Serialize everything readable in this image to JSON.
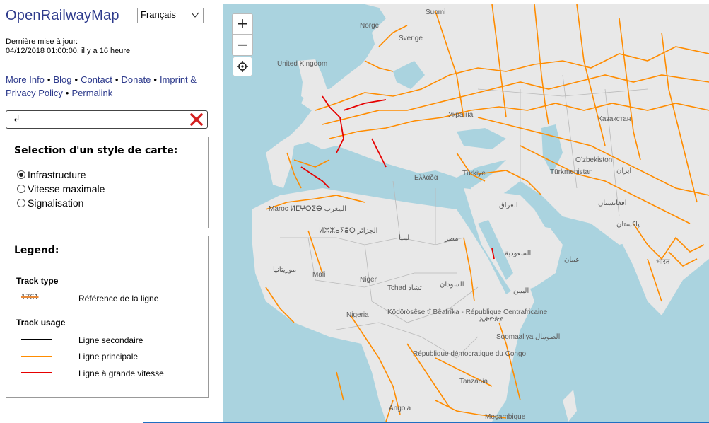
{
  "site": {
    "title": "OpenRailwayMap",
    "language_selected": "Français",
    "update_label": "Dernière mise à jour:",
    "update_value": "04/12/2018 01:00:00, il y a 16 heure"
  },
  "links": [
    "More Info",
    "Blog",
    "Contact",
    "Donate",
    "Imprint &",
    "Privacy Policy",
    "Permalink"
  ],
  "search": {
    "value": "↲"
  },
  "style_panel": {
    "title": "Selection d'un style de carte:",
    "options": [
      {
        "label": "Infrastructure",
        "selected": true
      },
      {
        "label": "Vitesse maximale",
        "selected": false
      },
      {
        "label": "Signalisation",
        "selected": false
      }
    ]
  },
  "legend": {
    "title": "Legend:",
    "track_type_heading": "Track type",
    "track_type_ref": "1761",
    "track_type_label": "Référence de la ligne",
    "track_usage_heading": "Track usage",
    "items": [
      {
        "label": "Ligne secondaire",
        "color": "#000000"
      },
      {
        "label": "Ligne principale",
        "color": "#ff8c00"
      },
      {
        "label": "Ligne à grande vitesse",
        "color": "#e60000"
      }
    ]
  },
  "map": {
    "zoom_in": "+",
    "zoom_out": "−",
    "colors": {
      "sea": "#aad3df",
      "land": "#e8e8e8",
      "rail": "#ff8c00",
      "highspeed": "#e60000"
    },
    "labels": [
      "Suomi",
      "Norge",
      "Sverige",
      "United Kingdom",
      "Україна",
      "Қазақстан",
      "Oʻzbekiston",
      "Türkmenistan",
      "ایران",
      "افغانستان",
      "پاکستان",
      "Ελλάδα",
      "Türkiye",
      "العراق",
      "Maroc ⵍⵎⵖⵔⵉⴱ المغرب",
      "ⵍⵣⵣⴰⵢⴻⵔ الجزائر",
      "ليبيا",
      "مصر",
      "السعودية",
      "عمان",
      "موريتانيا",
      "Mali",
      "Niger",
      "Tchad تشاد",
      "السودان",
      "اليمن",
      "ኢትዮጵያ",
      "Nigeria",
      "Ködörösêse tî Bêafrîka - République Centrafricaine",
      "République démocratique du Congo",
      "Soomaaliya الصومال",
      "Tanzania",
      "Angola",
      "Moçambique",
      "भारत"
    ]
  }
}
